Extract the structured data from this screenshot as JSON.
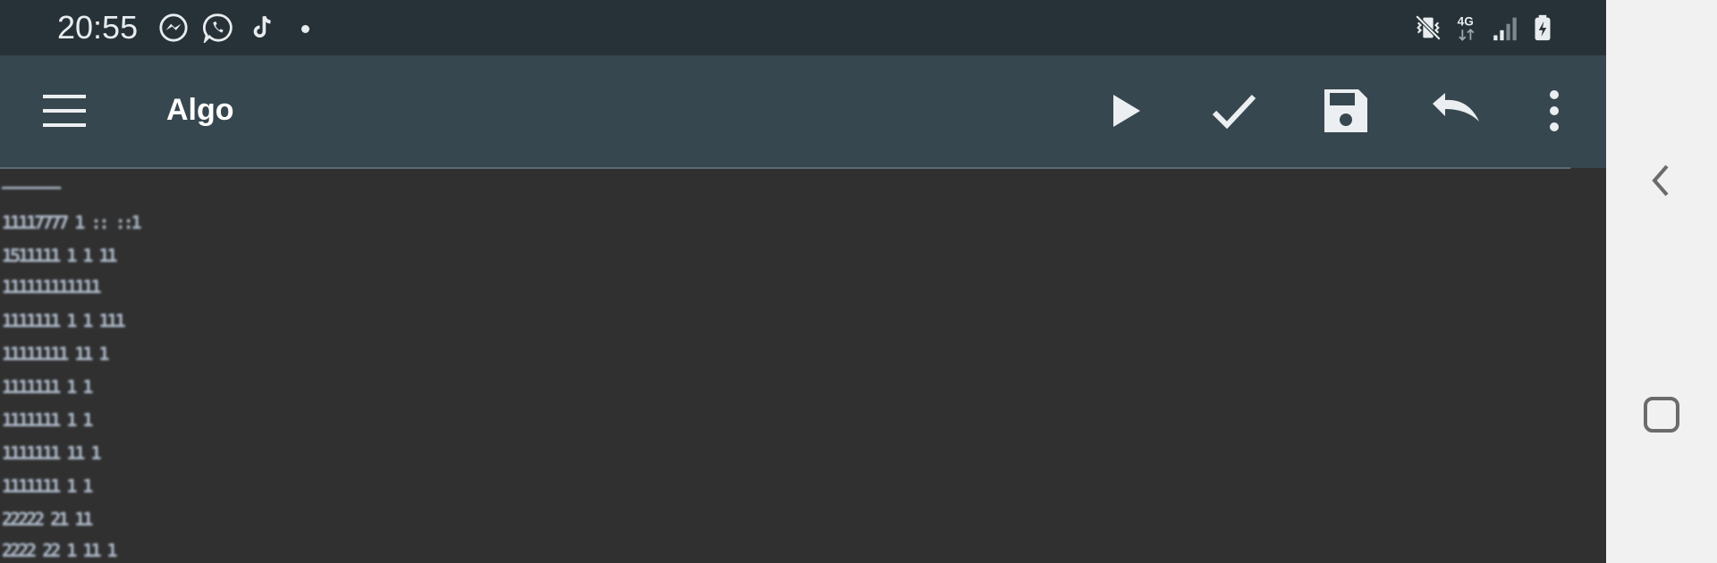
{
  "status_bar": {
    "time": "20:55",
    "left_icons": [
      "messenger-icon",
      "whatsapp-icon",
      "tiktok-icon",
      "notification-dot"
    ],
    "right_icons": [
      "vibrate-mute-icon",
      "network-4g-icon",
      "signal-icon",
      "battery-charging-icon"
    ],
    "network_label": "4G"
  },
  "toolbar": {
    "title": "Algo",
    "actions": [
      "menu-icon",
      "play-icon",
      "check-icon",
      "save-icon",
      "undo-icon",
      "more-vert-icon"
    ]
  },
  "editor": {
    "lines": [
      "———————",
      "11117777  1  ::  ::1",
      "1511111 1    1  11",
      "111111111111",
      "1111111 1   1  111",
      "11111111 11   1",
      "1111111  1   1",
      "1111111  1   1",
      "1111111 11  1",
      "1111111  1  1",
      "22222 21   11",
      "2222 22 1 11  1"
    ]
  },
  "nav_bar": {
    "buttons": [
      "back-icon",
      "recents-icon"
    ]
  },
  "colors": {
    "status_bar": "#263238",
    "toolbar": "#37474f",
    "editor_background": "#303030",
    "nav_bar": "#f1f1f1"
  }
}
